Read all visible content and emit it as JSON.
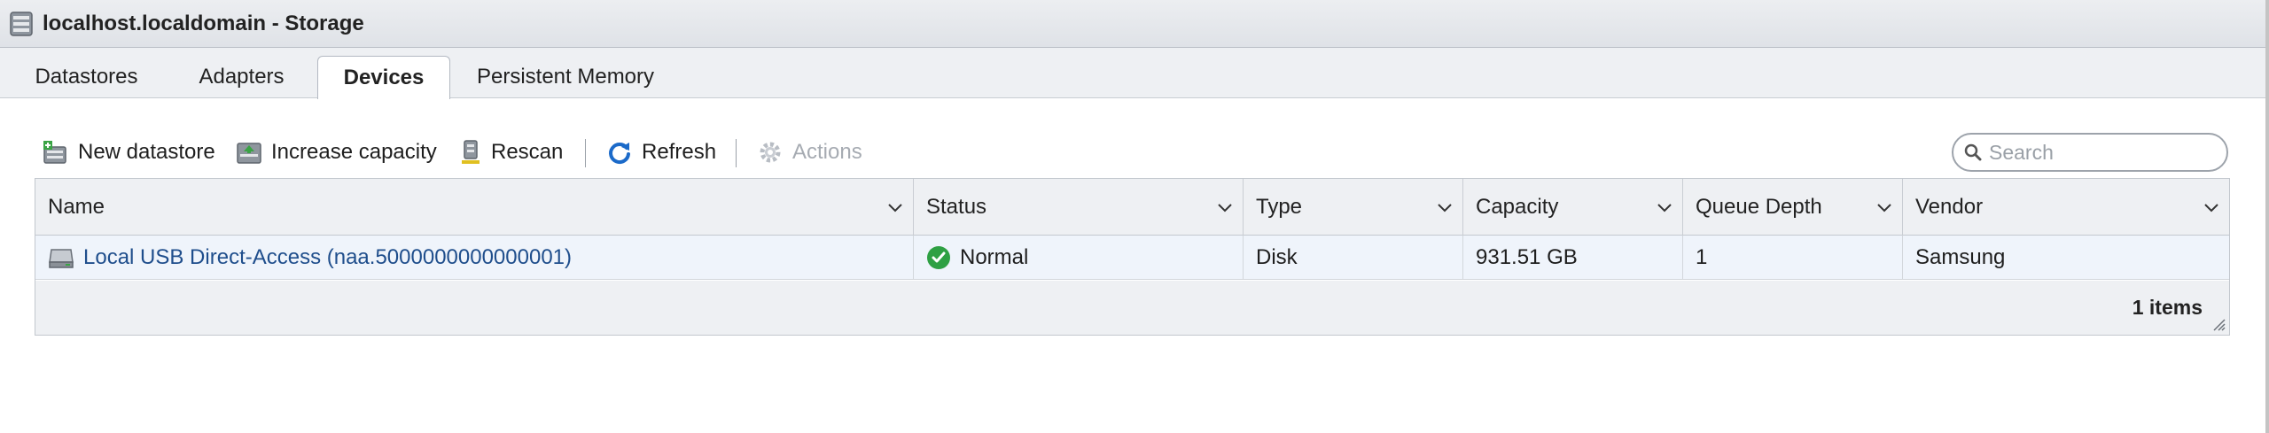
{
  "window": {
    "title": "localhost.localdomain - Storage",
    "icon": "storage-icon"
  },
  "tabs": [
    {
      "label": "Datastores",
      "active": false
    },
    {
      "label": "Adapters",
      "active": false
    },
    {
      "label": "Devices",
      "active": true
    },
    {
      "label": "Persistent Memory",
      "active": false
    }
  ],
  "toolbar": {
    "new_datastore": "New datastore",
    "increase_capacity": "Increase capacity",
    "rescan": "Rescan",
    "refresh": "Refresh",
    "actions": "Actions"
  },
  "search": {
    "placeholder": "Search",
    "value": ""
  },
  "table": {
    "columns": [
      "Name",
      "Status",
      "Type",
      "Capacity",
      "Queue Depth",
      "Vendor"
    ],
    "rows": [
      {
        "name": "Local USB Direct-Access (naa.5000000000000001)",
        "status": "Normal",
        "type": "Disk",
        "capacity": "931.51 GB",
        "queue_depth": "1",
        "vendor": "Samsung"
      }
    ],
    "footer": "1 items"
  },
  "colors": {
    "link": "#1f4e8c",
    "status_ok": "#2ea043",
    "refresh_blue": "#1b6ac9"
  }
}
